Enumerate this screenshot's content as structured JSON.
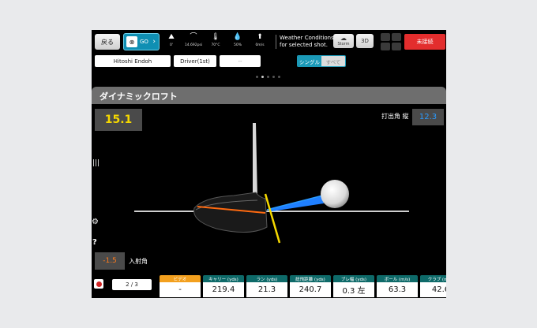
{
  "topbar": {
    "back_label": "戻る",
    "go_label": "GO",
    "weather": [
      {
        "icon": "mountain-icon",
        "glyph": "⛰",
        "value": "0'"
      },
      {
        "icon": "barometer-icon",
        "glyph": "⌒",
        "value": "14.692psi"
      },
      {
        "icon": "thermometer-icon",
        "glyph": "🌡",
        "value": "70°C"
      },
      {
        "icon": "humidity-icon",
        "glyph": "💧",
        "value": "50%"
      },
      {
        "icon": "wind-icon",
        "glyph": "⬆",
        "value": "0m/s"
      }
    ],
    "weather_note_1": "Weather Conditions",
    "weather_note_2": "for selected shot.",
    "storm_label": "Storm",
    "view3d_label": "3D",
    "unsaved_label": "未接続"
  },
  "selectors": {
    "player": "Hitoshi Endoh",
    "club": "Driver(1st)",
    "extra": "--",
    "seg_single": "シングル",
    "seg_all": "すべて"
  },
  "panel": {
    "title": "ダイナミックロフト",
    "dynamic_loft": "15.1",
    "launch_label": "打出角 縦",
    "launch_value": "12.3",
    "aoa_value": "-1.5",
    "aoa_label": "入射角"
  },
  "bottom": {
    "pager": "2 / 3",
    "stats": [
      {
        "label": "ビデオ",
        "value": "-"
      },
      {
        "label": "キャリー (yds)",
        "value": "219.4"
      },
      {
        "label": "ラン (yds)",
        "value": "21.3"
      },
      {
        "label": "総飛距離 (yds)",
        "value": "240.7"
      },
      {
        "label": "ブレ幅 (yds)",
        "value": "0.3 左"
      },
      {
        "label": "ボール (m/s)",
        "value": "63.3"
      },
      {
        "label": "クラブ (m/s)",
        "value": "42.6"
      }
    ]
  },
  "colors": {
    "accent": "#1b9ab8",
    "loft_value": "#f5d800",
    "launch_value": "#2a9bff",
    "aoa_value": "#ff7b1c",
    "video_header": "#f3a01e",
    "stat_header": "#0e6a69",
    "disconnected": "#e32d2d"
  }
}
